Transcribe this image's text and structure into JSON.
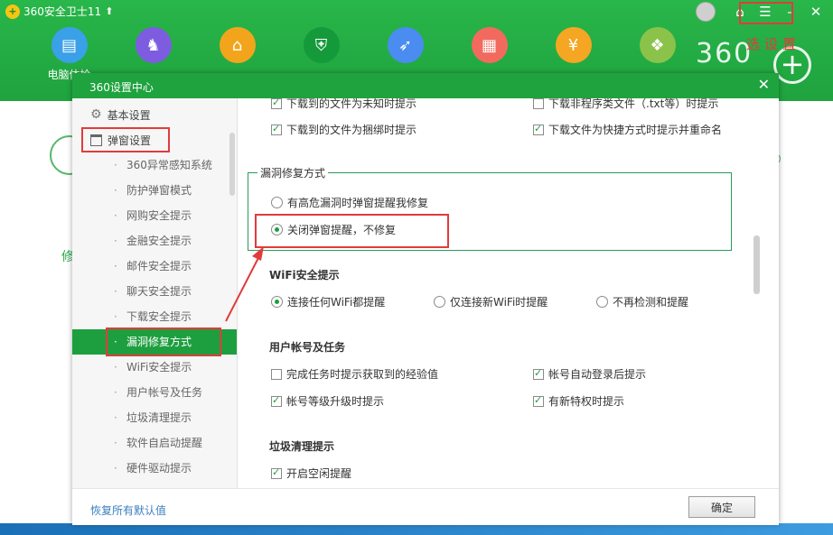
{
  "app": {
    "title": "360安全卫士11",
    "upgrade_glyph": "⬆",
    "logo_glyph": "+",
    "brand": "360",
    "annotation": "选设置"
  },
  "window_controls": {
    "avatar_icon": "avatar-icon",
    "skin_icon": "⌂",
    "menu_icon": "☰",
    "minimize_icon": "–",
    "close_icon": "✕"
  },
  "toolbar": [
    {
      "label": "电脑体检",
      "icon": "monitor-icon",
      "glyph": "▤",
      "color": "#3aa0e8"
    },
    {
      "label": "",
      "icon": "horse-icon",
      "glyph": "♞",
      "color": "#7d5ce0"
    },
    {
      "label": "",
      "icon": "broom-icon",
      "glyph": "⌂",
      "color": "#f2a51c"
    },
    {
      "label": "",
      "icon": "shield-icon",
      "glyph": "⛨",
      "color": "#149a3a"
    },
    {
      "label": "",
      "icon": "rocket-icon",
      "glyph": "➶",
      "color": "#4a8cf0"
    },
    {
      "label": "",
      "icon": "grid-icon",
      "glyph": "▦",
      "color": "#f26a5e"
    },
    {
      "label": "",
      "icon": "medal-icon",
      "glyph": "¥",
      "color": "#f5a623"
    },
    {
      "label": "",
      "icon": "apps-icon",
      "glyph": "❖",
      "color": "#8bc34a"
    }
  ],
  "background": {
    "fragment": "修"
  },
  "dialog": {
    "title": "360设置中心",
    "close": "✕",
    "sidebar": {
      "groups": [
        {
          "label": "基本设置",
          "icon": "gear-icon"
        },
        {
          "label": "弹窗设置",
          "icon": "window-icon"
        }
      ],
      "items": [
        "360异常感知系统",
        "防护弹窗模式",
        "网购安全提示",
        "金融安全提示",
        "邮件安全提示",
        "聊天安全提示",
        "下载安全提示",
        "漏洞修复方式",
        "WiFi安全提示",
        "用户帐号及任务",
        "垃圾清理提示",
        "软件自启动提醒",
        "硬件驱动提示"
      ],
      "active_item": "漏洞修复方式"
    },
    "content": {
      "download_partial": [
        {
          "label": "下载到的文件为未知时提示",
          "checked": true
        },
        {
          "label": "下载非程序类文件（.txt等）时提示",
          "checked": false
        }
      ],
      "download": [
        {
          "label": "下载到的文件为捆绑时提示",
          "checked": true
        },
        {
          "label": "下载文件为快捷方式时提示并重命名",
          "checked": true
        }
      ],
      "vuln": {
        "title": "漏洞修复方式",
        "options": [
          {
            "label": "有高危漏洞时弹窗提醒我修复",
            "checked": false
          },
          {
            "label": "关闭弹窗提醒，不修复",
            "checked": true
          }
        ]
      },
      "wifi": {
        "title": "WiFi安全提示",
        "options": [
          {
            "label": "连接任何WiFi都提醒",
            "checked": true
          },
          {
            "label": "仅连接新WiFi时提醒",
            "checked": false
          },
          {
            "label": "不再检测和提醒",
            "checked": false
          }
        ]
      },
      "account": {
        "title": "用户帐号及任务",
        "options": [
          {
            "label": "完成任务时提示获取到的经验值",
            "checked": false
          },
          {
            "label": "帐号自动登录后提示",
            "checked": true
          },
          {
            "label": "帐号等级升级时提示",
            "checked": true
          },
          {
            "label": "有新特权时提示",
            "checked": true
          }
        ]
      },
      "junk": {
        "title": "垃圾清理提示",
        "options": [
          {
            "label": "开启空闲提醒",
            "checked": true
          }
        ]
      }
    },
    "footer": {
      "restore": "恢复所有默认值",
      "ok": "确定"
    }
  }
}
